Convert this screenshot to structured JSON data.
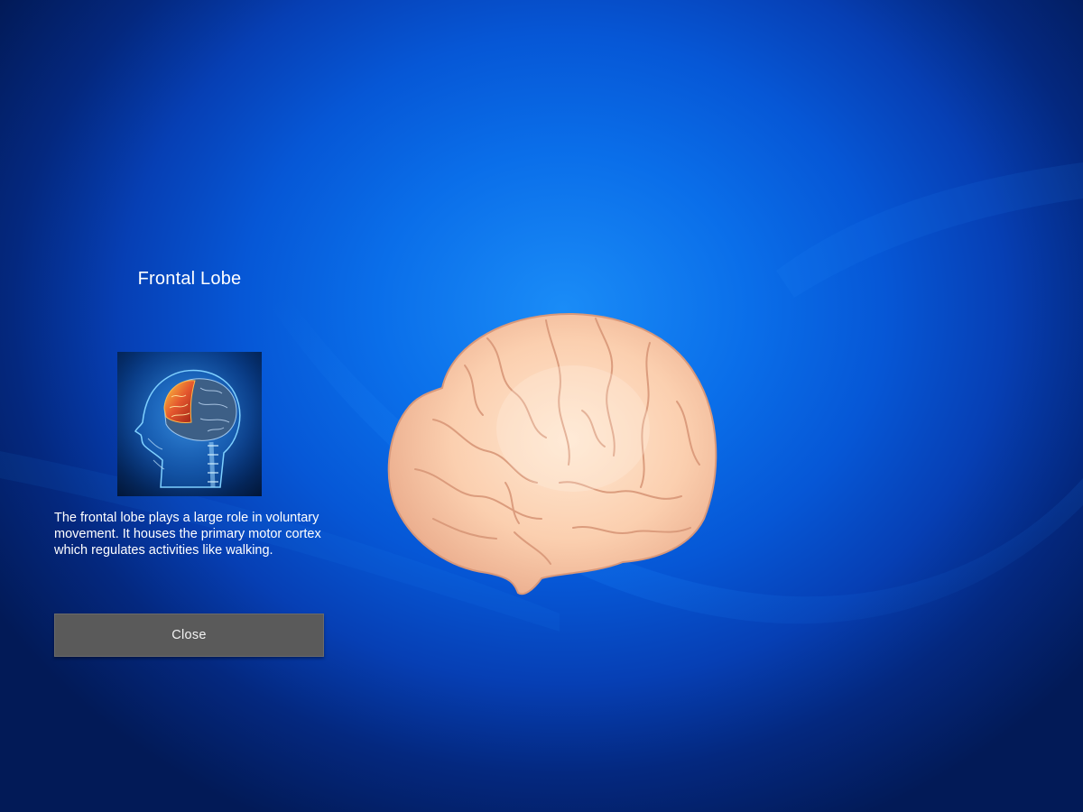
{
  "panel": {
    "title": "Frontal Lobe",
    "image_icon": "head-brain-frontal-lobe-illustration",
    "description": "The frontal lobe plays a large role in voluntary movement. It houses the primary motor cortex which regulates activities like walking.",
    "close_label": "Close"
  },
  "viewer": {
    "model_icon": "3d-brain-model"
  },
  "colors": {
    "background_center": "#1a8cf7",
    "background_edge": "#021a57",
    "button_bg": "#5a5a5a",
    "brain_skin": "#f8c8a6",
    "highlight_lobe": "#d8462a"
  }
}
